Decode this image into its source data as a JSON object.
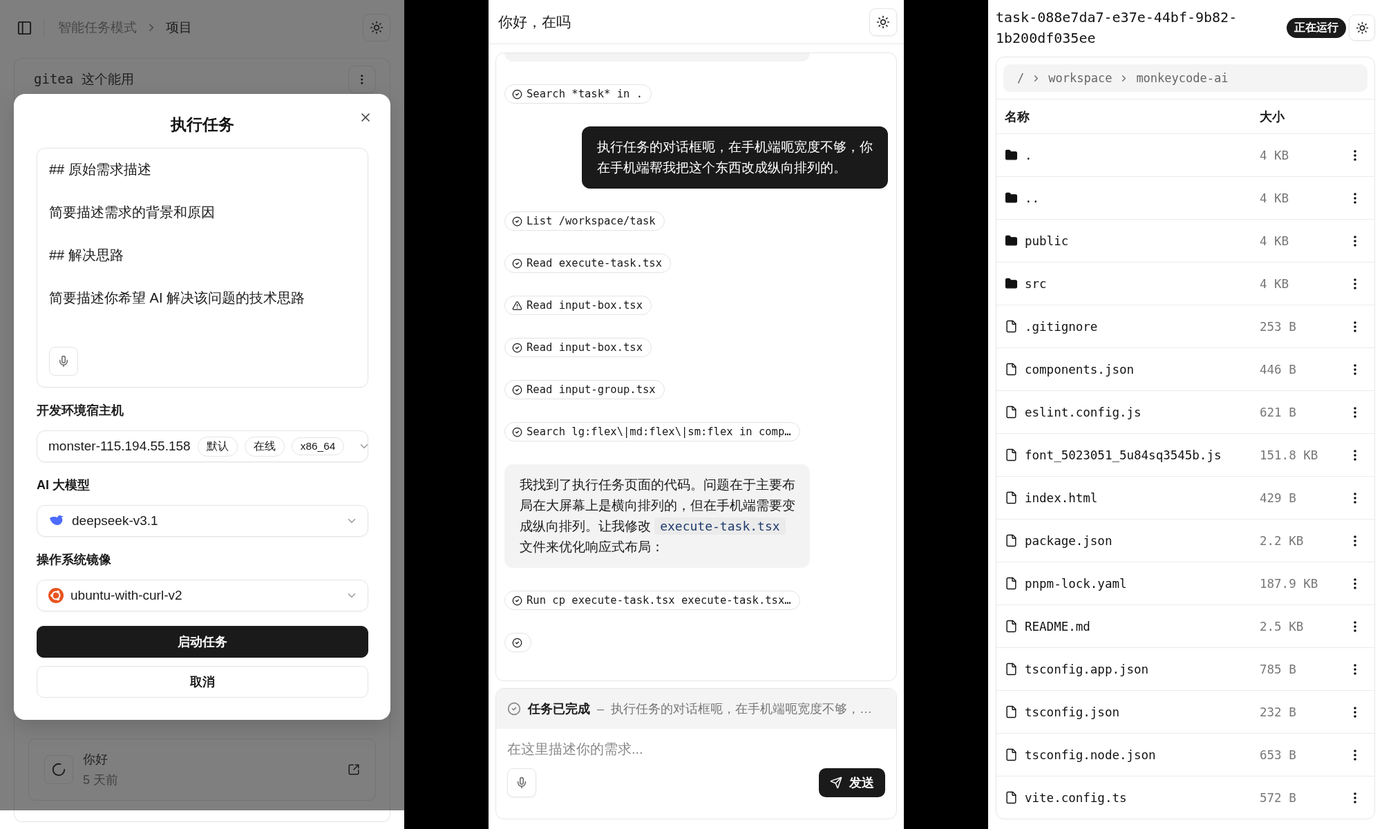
{
  "left_screen": {
    "breadcrumb": [
      "智能任务模式",
      "项目"
    ],
    "project_card": {
      "title": "gitea 这个能用"
    },
    "task_card": {
      "title": "你好",
      "time": "5 天前"
    },
    "dialog": {
      "title": "执行任务",
      "prompt_lines": [
        "## 原始需求描述",
        "简要描述需求的背景和原因",
        "## 解决思路",
        "简要描述你希望 AI 解决该问题的技术思路"
      ],
      "host_label": "开发环境宿主机",
      "host": {
        "value": "monster-115.194.55.158",
        "tags": [
          "默认",
          "在线",
          "x86_64"
        ]
      },
      "model_label": "AI 大模型",
      "model": "deepseek-v3.1",
      "image_label": "操作系统镜像",
      "image": "ubuntu-with-curl-v2",
      "buttons": [
        {
          "label": "启动任务",
          "kind": "primary"
        },
        {
          "label": "取消",
          "kind": "secondary"
        }
      ]
    }
  },
  "chat_screen": {
    "title": "你好，在吗",
    "messages": [
      {
        "kind": "tool",
        "warning": false,
        "text": "Search *task* in ."
      },
      {
        "kind": "user",
        "text": "执行任务的对话框呃，在手机端呃宽度不够，你在手机端帮我把这个东西改成纵向排列的。"
      },
      {
        "kind": "tool",
        "warning": false,
        "text": "List /workspace/task"
      },
      {
        "kind": "tool",
        "warning": false,
        "text": "Read execute-task.tsx"
      },
      {
        "kind": "tool",
        "warning": true,
        "text": "Read input-box.tsx"
      },
      {
        "kind": "tool",
        "warning": false,
        "text": "Read input-box.tsx"
      },
      {
        "kind": "tool",
        "warning": false,
        "text": "Read input-group.tsx"
      },
      {
        "kind": "tool",
        "warning": false,
        "text": "Search lg:flex\\|md:flex\\|sm:flex in comp…"
      },
      {
        "kind": "assistant",
        "parts": [
          {
            "kind": "text",
            "text": "我找到了执行任务页面的代码。问题在于主要布局在大屏幕上是横向排列的，但在手机端需要变成纵向排列。让我修改 "
          },
          {
            "kind": "code",
            "text": "execute-task.tsx"
          },
          {
            "kind": "text",
            "text": " 文件来优化响应式布局："
          }
        ]
      },
      {
        "kind": "tool",
        "warning": false,
        "text": "Run cp execute-task.tsx execute-task.tsx…"
      },
      {
        "kind": "tool",
        "warning": false
      }
    ],
    "status": {
      "title": "任务已完成",
      "separator": "–",
      "summary": "执行任务的对话框呃，在手机端呃宽度不够，…"
    },
    "composer": {
      "placeholder": "在这里描述你的需求...",
      "send": "发送"
    }
  },
  "files_screen": {
    "title": "task-088e7da7-e37e-44bf-9b82-1b200df035ee",
    "badge": "正在运行",
    "path": [
      "/",
      "workspace",
      "monkeycode-ai"
    ],
    "columns": [
      "名称",
      "大小"
    ],
    "rows": [
      {
        "kind": "folder",
        "name": ".",
        "size": "4 KB"
      },
      {
        "kind": "folder",
        "name": "..",
        "size": "4 KB"
      },
      {
        "kind": "folder",
        "name": "public",
        "size": "4 KB"
      },
      {
        "kind": "folder",
        "name": "src",
        "size": "4 KB"
      },
      {
        "kind": "file",
        "name": ".gitignore",
        "size": "253 B"
      },
      {
        "kind": "file",
        "name": "components.json",
        "size": "446 B"
      },
      {
        "kind": "file",
        "name": "eslint.config.js",
        "size": "621 B"
      },
      {
        "kind": "file",
        "name": "font_5023051_5u84sq3545b.js",
        "size": "151.8 KB"
      },
      {
        "kind": "file",
        "name": "index.html",
        "size": "429 B"
      },
      {
        "kind": "file",
        "name": "package.json",
        "size": "2.2 KB"
      },
      {
        "kind": "file",
        "name": "pnpm-lock.yaml",
        "size": "187.9 KB"
      },
      {
        "kind": "file",
        "name": "README.md",
        "size": "2.5 KB"
      },
      {
        "kind": "file",
        "name": "tsconfig.app.json",
        "size": "785 B"
      },
      {
        "kind": "file",
        "name": "tsconfig.json",
        "size": "232 B"
      },
      {
        "kind": "file",
        "name": "tsconfig.node.json",
        "size": "653 B"
      },
      {
        "kind": "file",
        "name": "vite.config.ts",
        "size": "572 B"
      }
    ]
  }
}
